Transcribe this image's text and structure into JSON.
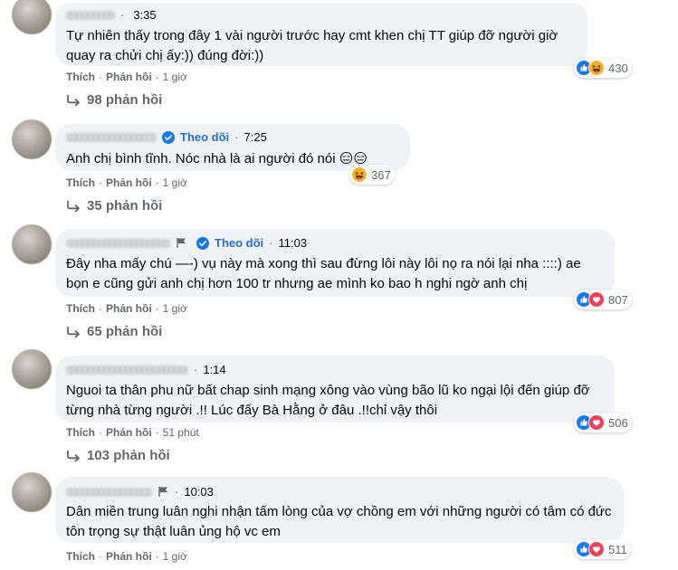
{
  "comments": [
    {
      "time": "3:35",
      "text": "Tự nhiên thấy trong đây 1 vài người trước hay cmt khen chị TT giúp đỡ người giờ quay ra chửi chị ấy:)) đúng đời:))",
      "actions": {
        "like": "Thích",
        "reply": "Phản hồi",
        "ago": "1 giờ"
      },
      "reactions": {
        "icons": [
          "like-icon",
          "haha-icon"
        ],
        "count": "430"
      },
      "replies": "98 phản hồi"
    },
    {
      "follow": "Theo dõi",
      "time": "7:25",
      "text": "Anh chị bình tĩnh. Nóc nhà là ai người đó nói 😑😑",
      "actions": {
        "like": "Thích",
        "reply": "Phản hồi",
        "ago": "1 giờ"
      },
      "reactions": {
        "icons": [
          "haha-icon"
        ],
        "count": "367"
      },
      "replies": "35 phản hồi"
    },
    {
      "follow": "Theo dõi",
      "time": "11:03",
      "text": "Đây nha mấy chú —-) vụ này mà xong thì sau đừng lôi này lôi nọ ra nói lại nha ::::) ae bọn e cũng gửi anh chị hơn 100 tr nhưng ae mình ko bao h nghi ngờ anh chị",
      "actions": {
        "like": "Thích",
        "reply": "Phản hồi",
        "ago": "1 giờ"
      },
      "reactions": {
        "icons": [
          "like-icon",
          "love-icon"
        ],
        "count": "807"
      },
      "replies": "65 phản hồi"
    },
    {
      "time": "1:14",
      "text": "Nguoi ta thân phu nữ bất chap sinh mạng xông vào vùng bão lũ ko ngại lội đến giúp đỡ từng nhà từng người .!! Lúc đấy Bà Hằng ở đâu .!!chỉ vậy thôi",
      "actions": {
        "like": "Thích",
        "reply": "Phản hồi",
        "ago": "51 phút"
      },
      "reactions": {
        "icons": [
          "like-icon",
          "love-icon"
        ],
        "count": "506"
      },
      "replies": "103 phản hồi"
    },
    {
      "time": "10:03",
      "text": "Dân miền trung luân nghi nhận tấm lòng của vợ chồng em với những người có tâm có đức tôn trọng sự thật luân ủng hộ vc em",
      "actions": {
        "like": "Thích",
        "reply": "Phản hồi",
        "ago": "1 giờ"
      },
      "reactions": {
        "icons": [
          "like-icon",
          "love-icon"
        ],
        "count": "511"
      }
    }
  ],
  "colors": {
    "bubble": "#f0f2f5",
    "link": "#216fdb",
    "muted": "#65676b",
    "like": "#1877f2",
    "love": "#f33e58",
    "haha": "#f7b125"
  }
}
